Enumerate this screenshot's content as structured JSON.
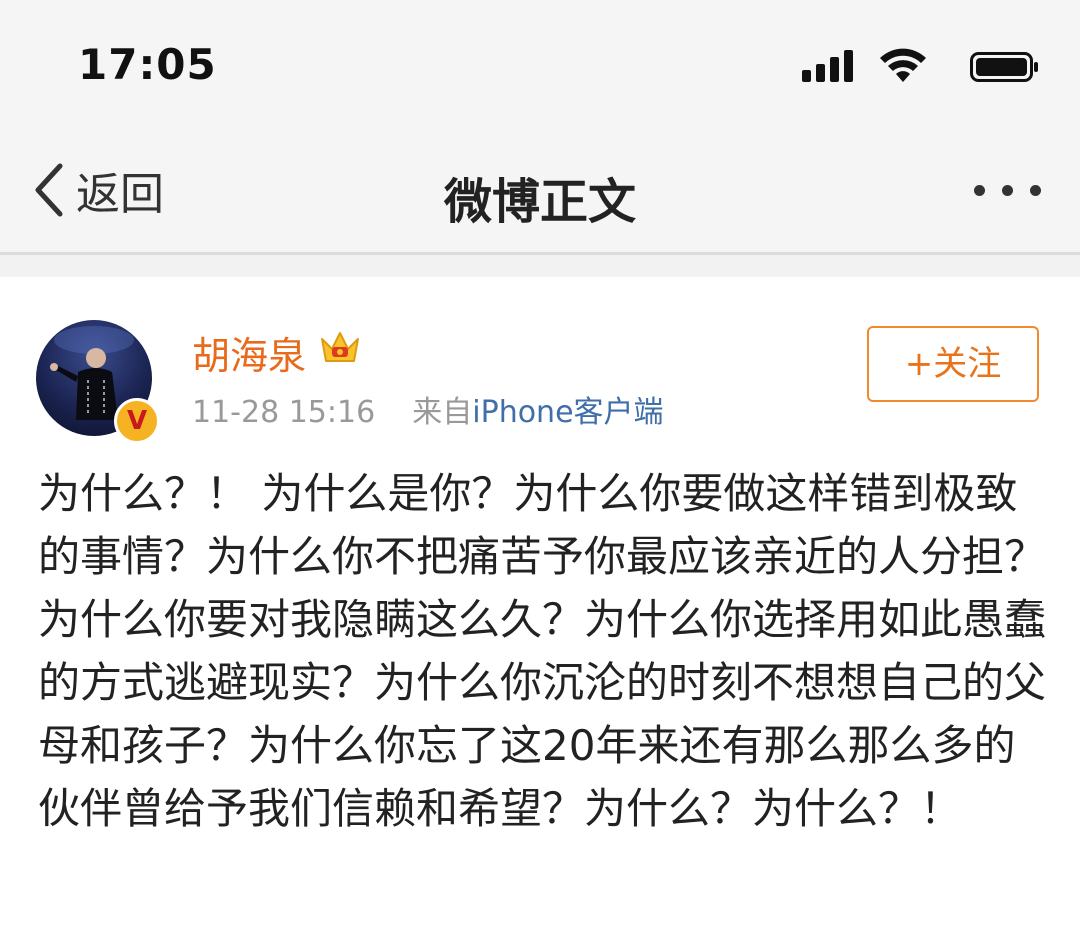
{
  "status_bar": {
    "time": "17:05"
  },
  "nav": {
    "back_label": "返回",
    "title": "微博正文"
  },
  "post": {
    "username": "胡海泉",
    "verified_mark": "V",
    "timestamp": "11-28 15:16",
    "source_prefix": "来自",
    "source_name": "iPhone客户端",
    "follow_label": "+关注",
    "body": "为什么？！ 为什么是你？为什么你要做这样错到极致的事情？为什么你不把痛苦予你最应该亲近的人分担？为什么你要对我隐瞒这么久？为什么你选择用如此愚蠢的方式逃避现实？为什么你沉沦的时刻不想想自己的父母和孩子？为什么你忘了这20年来还有那么那么多的伙伴曾给予我们信赖和希望？为什么？为什么？！"
  },
  "colors": {
    "username": "#e86a1a",
    "follow_border": "#f08a2c",
    "source_link": "#3f6ea8",
    "nav_bg": "#f5f5f5"
  },
  "icons": [
    "signal-icon",
    "wifi-icon",
    "battery-icon",
    "back-chevron-icon",
    "more-icon",
    "crown-icon",
    "verified-icon"
  ]
}
